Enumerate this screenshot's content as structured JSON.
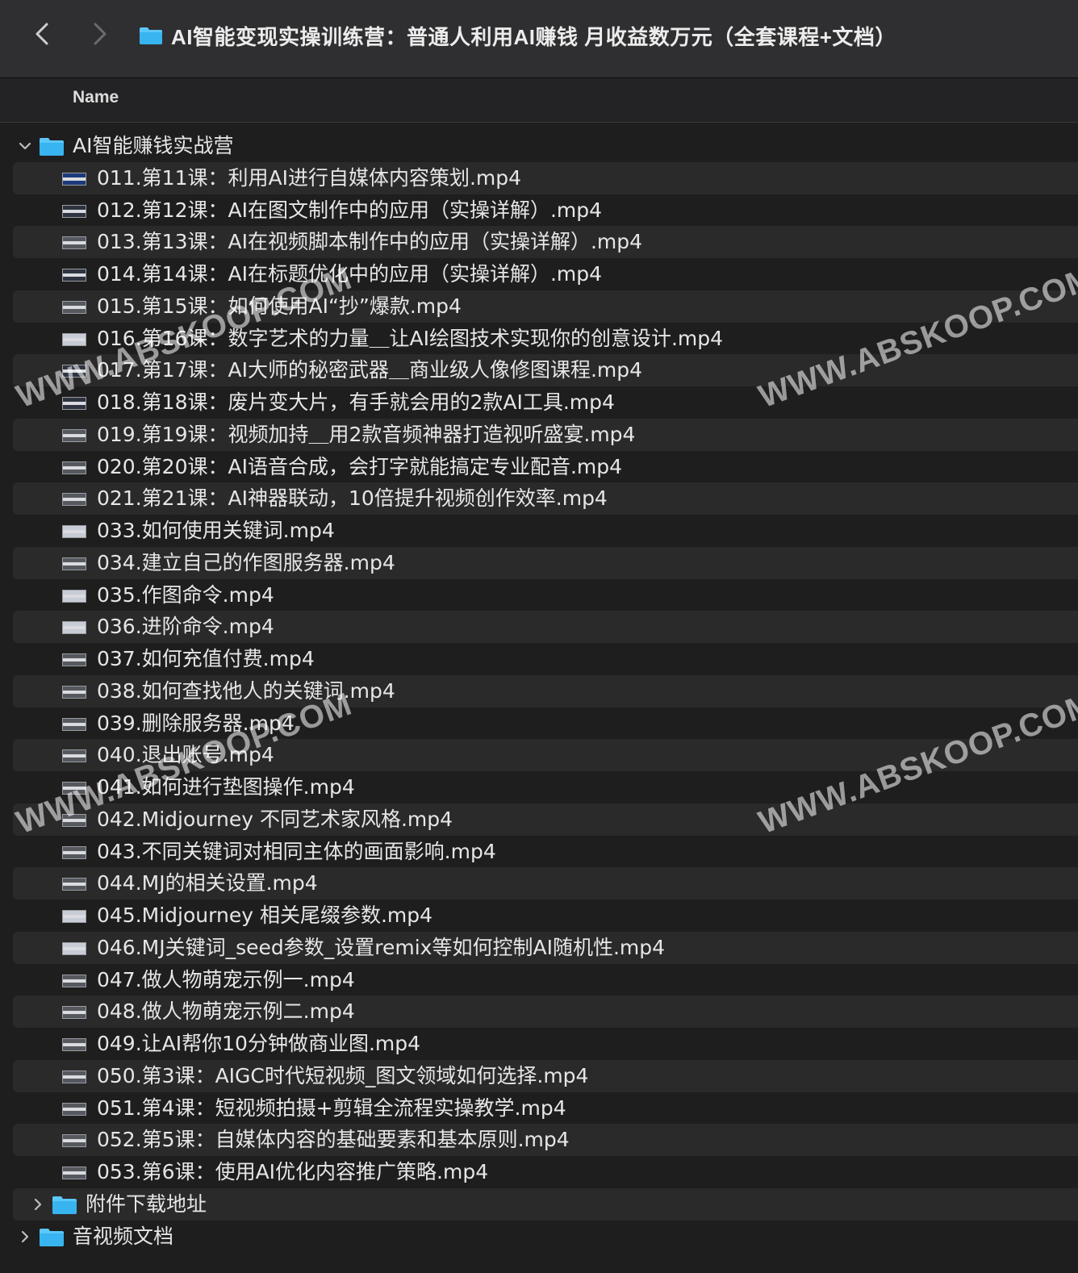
{
  "window": {
    "title": "AI智能变现实操训练营：普通人利用AI赚钱 月收益数万元（全套课程+文档）",
    "back_icon": "chevron-left-icon",
    "forward_icon": "chevron-right-icon"
  },
  "columns": {
    "name_label": "Name"
  },
  "colors": {
    "folder_blue": "#5ac8fa",
    "row_stripe": "#2a2a2b",
    "background": "#1e1e1e"
  },
  "tree": {
    "main_folder": {
      "label": "AI智能赚钱实战营",
      "expanded": true,
      "files": [
        "011.第11课：利用AI进行自媒体内容策划.mp4",
        "012.第12课：AI在图文制作中的应用（实操详解）.mp4",
        "013.第13课：AI在视频脚本制作中的应用（实操详解）.mp4",
        "014.第14课：AI在标题优化中的应用（实操详解）.mp4",
        "015.第15课：如何使用AI“抄”爆款.mp4",
        "016.第16课：数字艺术的力量＿让AI绘图技术实现你的创意设计.mp4",
        "017.第17课：AI大师的秘密武器＿商业级人像修图课程.mp4",
        "018.第18课：废片变大片，有手就会用的2款AI工具.mp4",
        "019.第19课：视频加持＿用2款音频神器打造视听盛宴.mp4",
        "020.第20课：AI语音合成，会打字就能搞定专业配音.mp4",
        "021.第21课：AI神器联动，10倍提升视频创作效率.mp4",
        "033.如何使用关键词.mp4",
        "034.建立自己的作图服务器.mp4",
        "035.作图命令.mp4",
        "036.进阶命令.mp4",
        "037.如何充值付费.mp4",
        "038.如何查找他人的关键词.mp4",
        "039.删除服务器.mp4",
        "040.退出账号.mp4",
        "041.如何进行垫图操作.mp4",
        "042.Midjourney 不同艺术家风格.mp4",
        "043.不同关键词对相同主体的画面影响.mp4",
        "044.MJ的相关设置.mp4",
        "045.Midjourney 相关尾缀参数.mp4",
        "046.MJ关键词_seed参数_设置remix等如何控制AI随机性.mp4",
        "047.做人物萌宠示例一.mp4",
        "048.做人物萌宠示例二.mp4",
        "049.让AI帮你10分钟做商业图.mp4",
        "050.第3课：AIGC时代短视频_图文领域如何选择.mp4",
        "051.第4课：短视频拍摄+剪辑全流程实操教学.mp4",
        "052.第5课：自媒体内容的基础要素和基本原则.mp4",
        "053.第6课：使用AI优化内容推广策略.mp4"
      ]
    },
    "other_folders": [
      {
        "label": "附件下载地址",
        "expanded": false
      },
      {
        "label": "音视频文档",
        "expanded": false
      }
    ]
  },
  "watermark_text": "WWW.ABSKOOP.COM"
}
